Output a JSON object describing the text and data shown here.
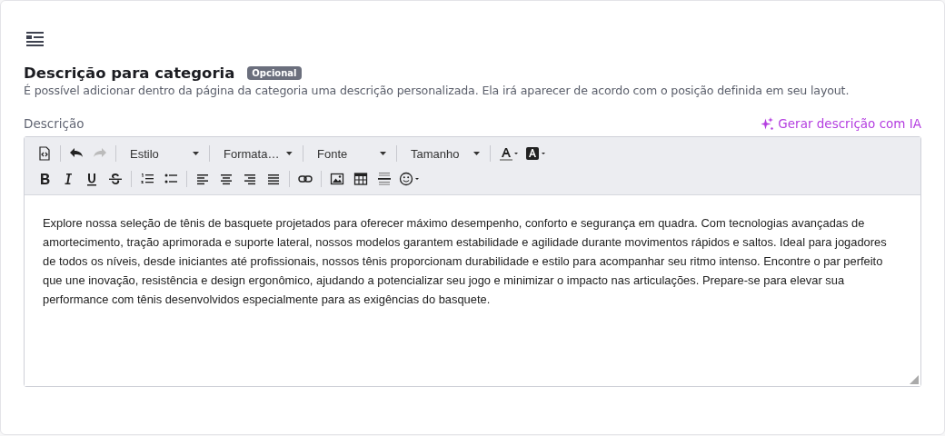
{
  "section": {
    "title": "Descrição para categoria",
    "badge": "Opcional",
    "description": "É possível adicionar dentro da página da categoria uma descrição personalizada. Ela irá aparecer de acordo com o posição definida em seu layout."
  },
  "field": {
    "label": "Descrição",
    "ai_link": "Gerar descrição com IA"
  },
  "toolbar": [
    [
      {
        "kind": "source",
        "disabled": false
      },
      {
        "kind": "separator"
      },
      {
        "kind": "undo",
        "disabled": false
      },
      {
        "kind": "redo",
        "disabled": true
      },
      {
        "kind": "separator"
      },
      {
        "kind": "dropdown",
        "label": "Estilo"
      },
      {
        "kind": "separator"
      },
      {
        "kind": "dropdown",
        "label": "Formata…"
      },
      {
        "kind": "separator"
      },
      {
        "kind": "dropdown",
        "label": "Fonte"
      },
      {
        "kind": "separator"
      },
      {
        "kind": "dropdown",
        "label": "Tamanho"
      },
      {
        "kind": "separator"
      },
      {
        "kind": "textcolor",
        "disabled": false
      },
      {
        "kind": "bgcolor",
        "disabled": false
      }
    ],
    [
      {
        "kind": "bold",
        "disabled": false
      },
      {
        "kind": "italic",
        "disabled": false
      },
      {
        "kind": "underline",
        "disabled": false
      },
      {
        "kind": "strike",
        "disabled": false
      },
      {
        "kind": "separator"
      },
      {
        "kind": "numlist",
        "disabled": false
      },
      {
        "kind": "bullist",
        "disabled": false
      },
      {
        "kind": "separator"
      },
      {
        "kind": "alignleft",
        "disabled": false
      },
      {
        "kind": "aligncenter",
        "disabled": false
      },
      {
        "kind": "alignright",
        "disabled": false
      },
      {
        "kind": "justify",
        "disabled": false
      },
      {
        "kind": "separator"
      },
      {
        "kind": "link",
        "disabled": false
      },
      {
        "kind": "separator"
      },
      {
        "kind": "image",
        "disabled": false
      },
      {
        "kind": "table",
        "disabled": false
      },
      {
        "kind": "hr",
        "disabled": false
      },
      {
        "kind": "emoji",
        "disabled": false
      }
    ]
  ],
  "content": "Explore nossa seleção de tênis de basquete projetados para oferecer máximo desempenho, conforto e segurança em quadra. Com tecnologias avançadas de amortecimento, tração aprimorada e suporte lateral, nossos modelos garantem estabilidade e agilidade durante movimentos rápidos e saltos. Ideal para jogadores de todos os níveis, desde iniciantes até profissionais, nossos tênis proporcionam durabilidade e estilo para acompanhar seu ritmo intenso. Encontre o par perfeito que une inovação, resistência e design ergonômico, ajudando a potencializar seu jogo e minimizar o impacto nas articulações. Prepare-se para elevar sua performance com tênis desenvolvidos especialmente para as exigências do basquete."
}
